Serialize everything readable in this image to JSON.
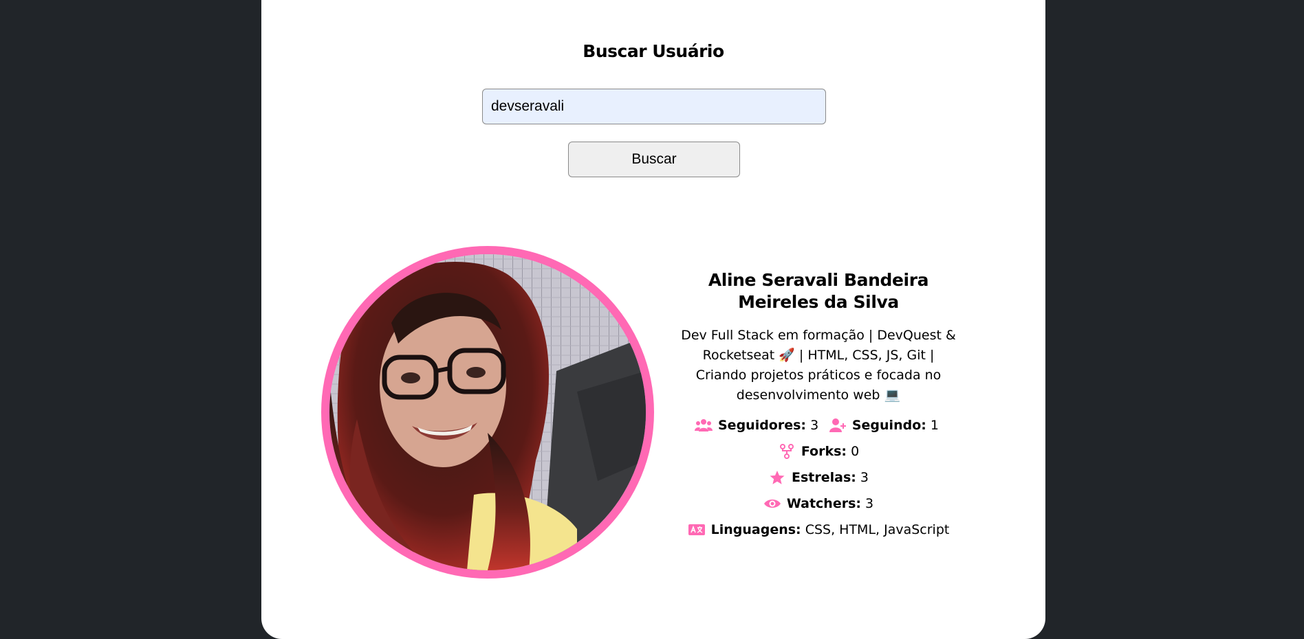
{
  "search": {
    "title": "Buscar Usuário",
    "input_value": "devseravali",
    "button_label": "Buscar"
  },
  "profile": {
    "name": "Aline Seravali Bandeira Meireles da Silva",
    "bio": "Dev Full Stack em formação | DevQuest & Rocketseat 🚀 | HTML, CSS, JS, Git | Criando projetos práticos e focada no desenvolvimento web 💻",
    "stats": {
      "followers_label": "Seguidores:",
      "followers_value": "3",
      "following_label": "Seguindo:",
      "following_value": "1",
      "forks_label": "Forks:",
      "forks_value": "0",
      "stars_label": "Estrelas:",
      "stars_value": "3",
      "watchers_label": "Watchers:",
      "watchers_value": "3",
      "languages_label": "Linguagens:",
      "languages_value": "CSS, HTML, JavaScript"
    }
  },
  "icons": {
    "followers": "users-icon",
    "following": "user-plus-icon",
    "forks": "code-fork-icon",
    "stars": "star-icon",
    "watchers": "eye-icon",
    "languages": "language-icon"
  },
  "colors": {
    "background": "#212529",
    "card": "#ffffff",
    "accent": "#ff69b4",
    "input_bg": "#e8f0fe"
  }
}
